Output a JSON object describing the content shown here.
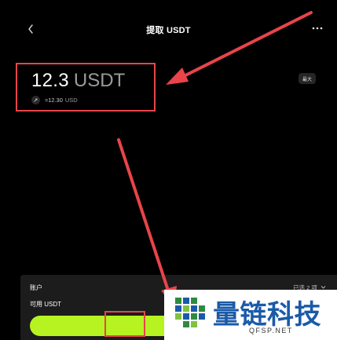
{
  "header": {
    "title": "提取 USDT",
    "back_icon": "chevron-left-icon",
    "more_icon": "more-dots-icon"
  },
  "amount": {
    "value": "12.3",
    "unit": "USDT",
    "fiat_value": "≈12.30",
    "fiat_unit": "USD",
    "swap_icon": "swap-icon"
  },
  "max_button": {
    "label": "最大"
  },
  "sheet": {
    "account_label": "账户",
    "selected_label": "已选 2 项",
    "available_label": "可用 USDT"
  },
  "watermark": {
    "title": "量链科技",
    "domain": "QFSP.NET"
  },
  "colors": {
    "background": "#000000",
    "accent": "#b6f321",
    "annotation": "#e8444a",
    "watermark_blue": "#1a5aa8"
  }
}
